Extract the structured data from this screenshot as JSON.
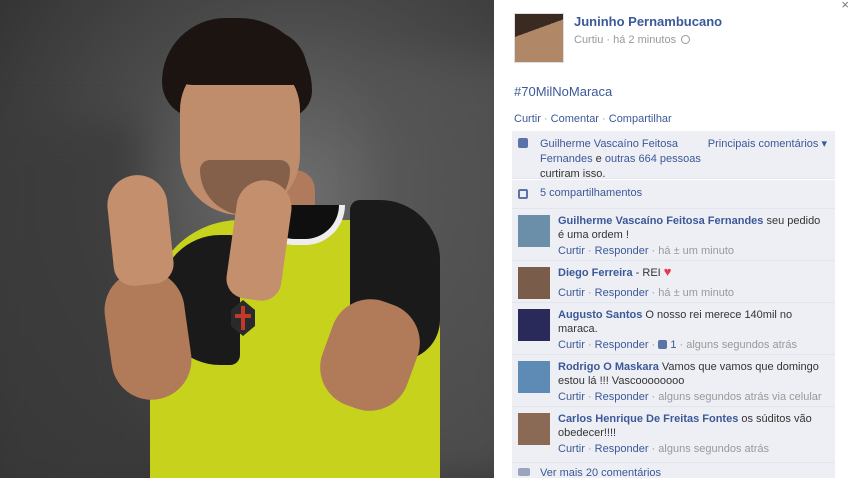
{
  "post": {
    "author": "Juninho Pernambucano",
    "meta": "Curtiu · há 2 minutos",
    "hashtag": "#70MilNoMaraca",
    "actions": {
      "like": "Curtir",
      "comment": "Comentar",
      "share": "Compartilhar"
    }
  },
  "likes": {
    "name": "Guilherme Vascaíno Feitosa Fernandes",
    "conj": " e ",
    "others": "outras 664 pessoas",
    "suffix": " curtiram isso.",
    "sort": "Principais comentários ▾"
  },
  "shares": {
    "label": "5 compartilhamentos"
  },
  "comments": [
    {
      "name": "Guilherme Vascaíno Feitosa Fernandes",
      "text": " seu pedido é uma ordem !",
      "like": "Curtir",
      "reply": "Responder",
      "time": "há ± um minuto",
      "avatar": "#6b8fa8"
    },
    {
      "name": "Diego Ferreira",
      "text": " - REI ",
      "like": "Curtir",
      "reply": "Responder",
      "time": "há ± um minuto",
      "avatar": "#7a5c4a"
    },
    {
      "name": "Augusto Santos",
      "text": " O nosso rei merece 140mil no maraca.",
      "like": "Curtir",
      "reply": "Responder",
      "likes": "1",
      "time": "alguns segundos atrás",
      "avatar": "#2a2a5a"
    },
    {
      "name": "Rodrigo O Maskara",
      "text": " Vamos que vamos que domingo estou lá !!! Vascoooooooo",
      "like": "Curtir",
      "reply": "Responder",
      "time": "alguns segundos atrás via celular",
      "avatar": "#5d8bb5"
    },
    {
      "name": "Carlos Henrique De Freitas Fontes",
      "text": " os súditos vão obedecer!!!!",
      "like": "Curtir",
      "reply": "Responder",
      "time": "alguns segundos atrás",
      "avatar": "#8a6a55"
    }
  ],
  "more_comments": "Ver mais 20 comentários",
  "colors": {
    "link": "#3b5998",
    "panel": "#edeff4",
    "shirt": "#c7d21c"
  }
}
